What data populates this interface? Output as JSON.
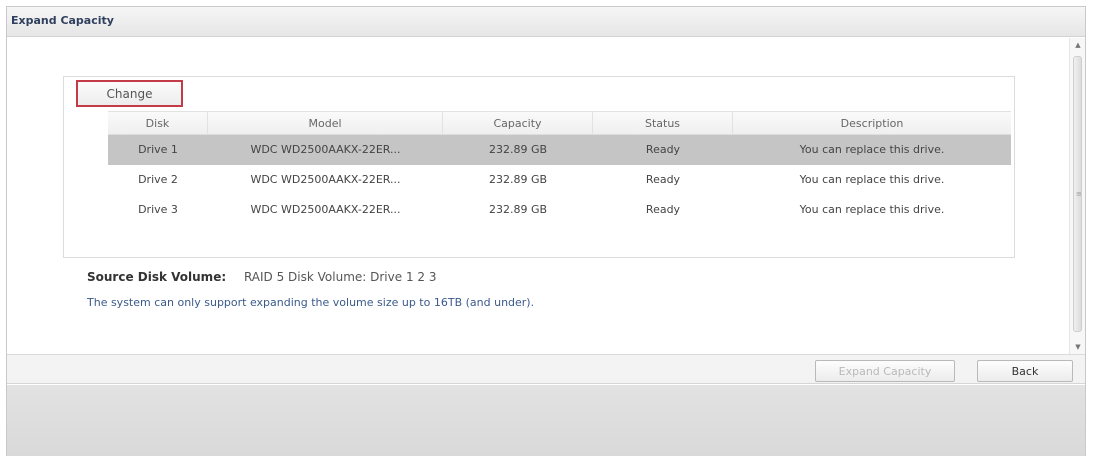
{
  "window": {
    "title": "Expand Capacity"
  },
  "toolbar": {
    "change_label": "Change"
  },
  "grid": {
    "columns": [
      "Disk",
      "Model",
      "Capacity",
      "Status",
      "Description"
    ],
    "rows": [
      {
        "disk": "Drive 1",
        "model": "WDC WD2500AAKX-22ER...",
        "capacity": "232.89 GB",
        "status": "Ready",
        "description": "You can replace this drive.",
        "selected": true
      },
      {
        "disk": "Drive 2",
        "model": "WDC WD2500AAKX-22ER...",
        "capacity": "232.89 GB",
        "status": "Ready",
        "description": "You can replace this drive.",
        "selected": false
      },
      {
        "disk": "Drive 3",
        "model": "WDC WD2500AAKX-22ER...",
        "capacity": "232.89 GB",
        "status": "Ready",
        "description": "You can replace this drive.",
        "selected": false
      }
    ]
  },
  "source": {
    "label": "Source Disk Volume:",
    "value": "RAID 5 Disk Volume: Drive 1 2 3"
  },
  "notice": "The system can only support expanding the volume size up to 16TB (and under).",
  "footer": {
    "expand_label": "Expand Capacity",
    "back_label": "Back"
  },
  "icons": {
    "scroll_up": "triangle-up-icon",
    "scroll_down": "triangle-down-icon",
    "grip": "grip-icon"
  }
}
